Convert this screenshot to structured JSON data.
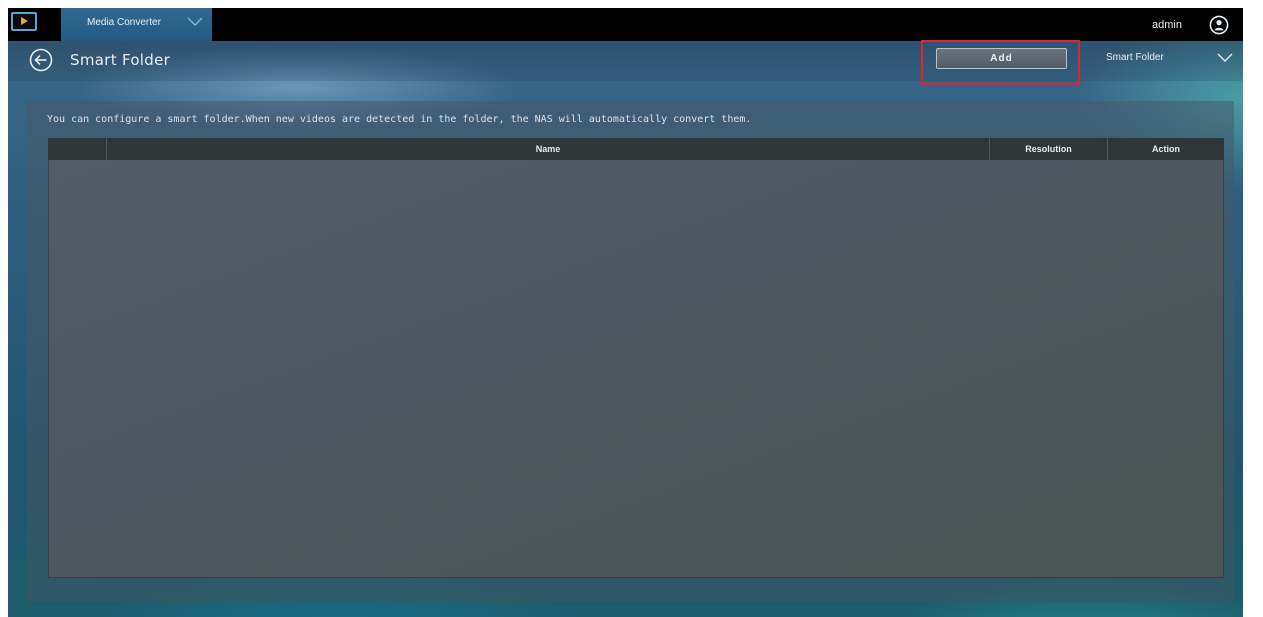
{
  "topbar": {
    "app_name": "Media Converter",
    "user": "admin",
    "icons": {
      "logo": "media-converter-logo-icon",
      "tab_menu": "chevron-down-icon",
      "user": "user-account-icon"
    }
  },
  "header": {
    "title": "Smart Folder",
    "add_label": "Add",
    "view_select": {
      "selected": "Smart Folder"
    },
    "icons": {
      "back": "back-arrow-icon",
      "select": "chevron-down-icon"
    }
  },
  "main": {
    "description": "You can configure a smart folder.When new videos are detected in the folder, the NAS will automatically convert them.",
    "table": {
      "columns": [
        "",
        "Name",
        "Resolution",
        "Action"
      ],
      "rows": []
    }
  },
  "colors": {
    "topbar": "#000000",
    "tab": "#2f6a93",
    "highlight": "#e0242b",
    "table_header": "#303538"
  }
}
